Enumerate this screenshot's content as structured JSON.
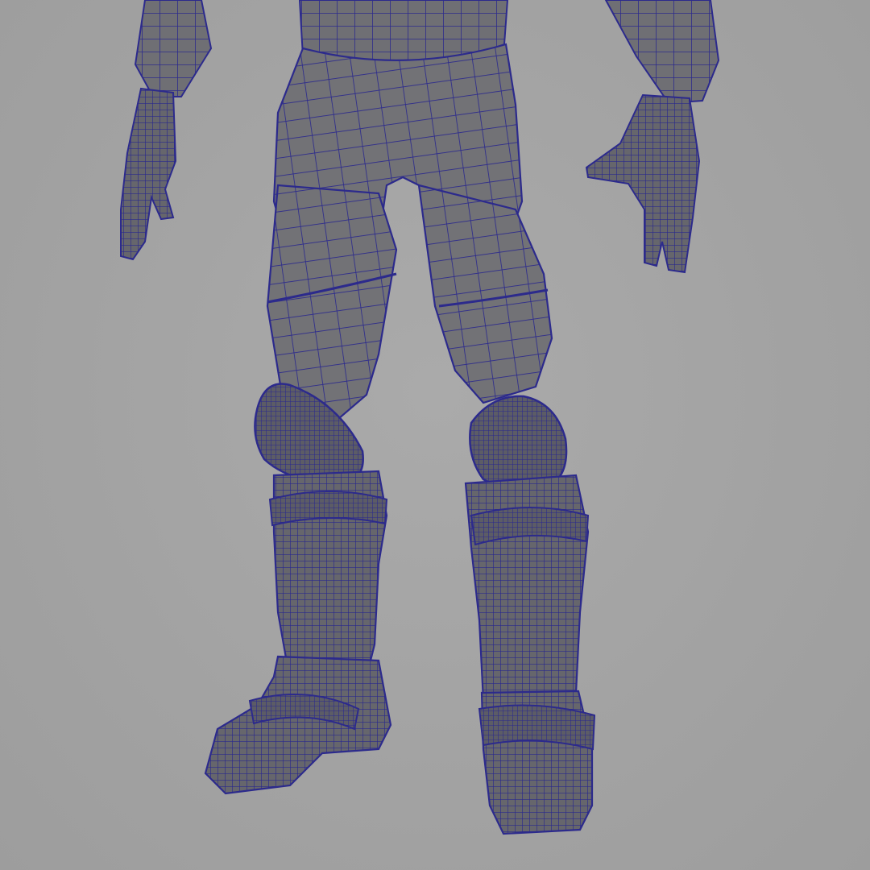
{
  "scene": {
    "background_color": "#a3a3a3",
    "mesh_fill_color": "#6c6c70",
    "mesh_shade_color": "#55555c",
    "wire_color": "#2c2a8c",
    "wire_color_dense": "#27258a"
  }
}
